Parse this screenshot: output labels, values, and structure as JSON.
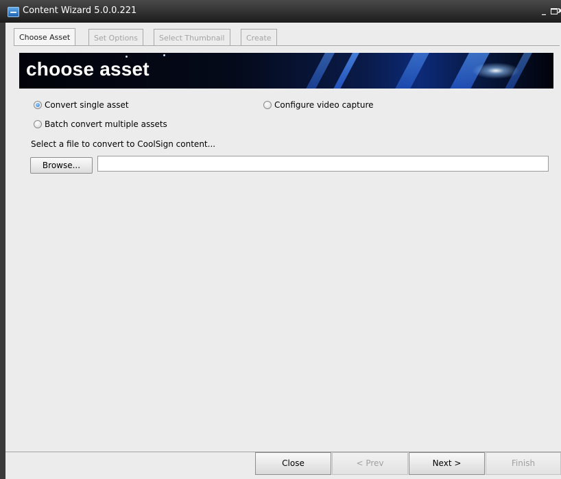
{
  "window": {
    "title": "Content Wizard 5.0.0.221",
    "controls": {
      "minimize": "_",
      "maximize": "",
      "close": "x"
    }
  },
  "tabs": [
    {
      "label": "Choose Asset",
      "state": "active"
    },
    {
      "label": "Set Options",
      "state": "disabled"
    },
    {
      "label": "Select Thumbnail",
      "state": "disabled"
    },
    {
      "label": "Create",
      "state": "disabled"
    }
  ],
  "banner": {
    "title": "choose asset"
  },
  "options": {
    "convert_single": {
      "label": "Convert single asset",
      "checked": true
    },
    "configure_video": {
      "label": "Configure video capture",
      "checked": false
    },
    "batch_convert": {
      "label": "Batch convert multiple assets",
      "checked": false
    }
  },
  "file": {
    "prompt": "Select a file to convert to CoolSign content...",
    "browse_label": "Browse...",
    "path_value": ""
  },
  "footer": {
    "close_label": "Close",
    "prev_label": "< Prev",
    "next_label": "Next >",
    "finish_label": "Finish"
  },
  "colors": {
    "accent": "#2a7bd8",
    "titlebar": "#2a2a2a",
    "banner_dark": "#02030a",
    "banner_blue": "#1a4ed0",
    "disabled_text": "#a0a0a0"
  }
}
